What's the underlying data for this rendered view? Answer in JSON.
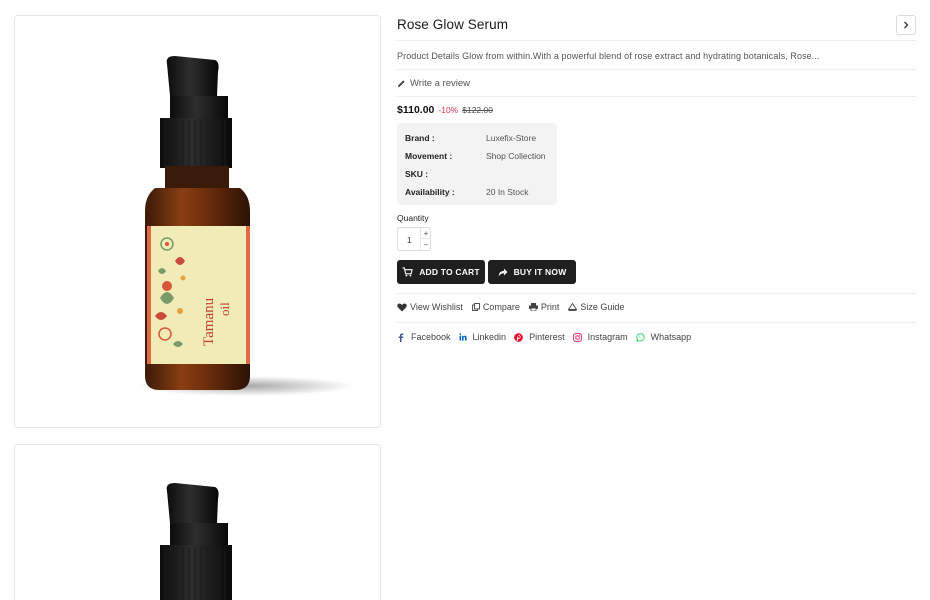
{
  "product": {
    "title": "Rose Glow Serum",
    "description": "Product Details Glow from within.With a powerful blend of rose extract and hydrating botanicals, Rose...",
    "review_label": "Write a review",
    "price": "$110.00",
    "discount": "-10%",
    "old_price": "$122.00",
    "bottle_label_title": "Tamanu",
    "bottle_label_sub": "oil"
  },
  "meta": [
    {
      "label": "Brand :",
      "value": "Luxefix-Store"
    },
    {
      "label": "Movement :",
      "value": "Shop Collection"
    },
    {
      "label": "SKU :",
      "value": ""
    },
    {
      "label": "Availability :",
      "value": "20 In Stock"
    }
  ],
  "quantity": {
    "label": "Quantity",
    "value": "1",
    "plus": "+",
    "minus": "–"
  },
  "buttons": {
    "add_to_cart": "ADD TO CART",
    "buy_now": "BUY IT NOW"
  },
  "actions": [
    {
      "label": "View Wishlist",
      "icon": "heart-icon"
    },
    {
      "label": "Compare",
      "icon": "compare-icon"
    },
    {
      "label": "Print",
      "icon": "print-icon"
    },
    {
      "label": "Size Guide",
      "icon": "size-guide-icon"
    }
  ],
  "social": [
    {
      "label": "Facebook",
      "icon": "facebook-icon",
      "color": "#3b5998"
    },
    {
      "label": "Linkedin",
      "icon": "linkedin-icon",
      "color": "#0a66c2"
    },
    {
      "label": "Pinterest",
      "icon": "pinterest-icon",
      "color": "#e60023"
    },
    {
      "label": "Instagram",
      "icon": "instagram-icon",
      "color": "#e1306c"
    },
    {
      "label": "Whatsapp",
      "icon": "whatsapp-icon",
      "color": "#25d366"
    }
  ],
  "colors": {
    "discount": "#e0324b",
    "button_bg": "#1f1f1f",
    "meta_bg": "#f3f3f3"
  }
}
